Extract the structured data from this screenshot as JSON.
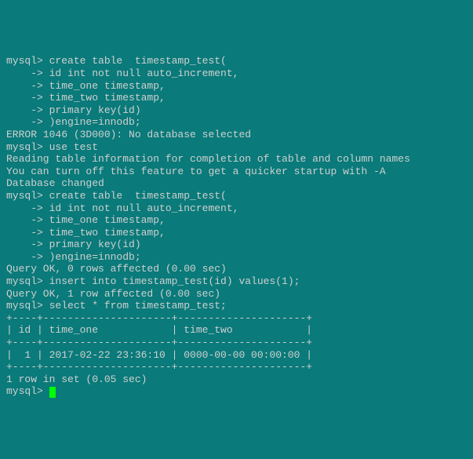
{
  "lines": [
    "mysql> create table  timestamp_test(",
    "    -> id int not null auto_increment,",
    "    -> time_one timestamp,",
    "    -> time_two timestamp,",
    "    -> primary key(id)",
    "    -> )engine=innodb;",
    "ERROR 1046 (3D000): No database selected",
    "mysql> use test",
    "Reading table information for completion of table and column names",
    "You can turn off this feature to get a quicker startup with -A",
    "",
    "Database changed",
    "mysql> create table  timestamp_test(",
    "    -> id int not null auto_increment,",
    "    -> time_one timestamp,",
    "    -> time_two timestamp,",
    "    -> primary key(id)",
    "    -> )engine=innodb;",
    "Query OK, 0 rows affected (0.00 sec)",
    "",
    "mysql> insert into timestamp_test(id) values(1);",
    "Query OK, 1 row affected (0.00 sec)",
    "",
    "mysql> select * from timestamp_test;",
    "+----+---------------------+---------------------+",
    "| id | time_one            | time_two            |",
    "+----+---------------------+---------------------+",
    "|  1 | 2017-02-22 23:36:10 | 0000-00-00 00:00:00 |",
    "+----+---------------------+---------------------+",
    "1 row in set (0.05 sec)",
    "",
    "mysql> "
  ],
  "cursor_line_index": 31
}
